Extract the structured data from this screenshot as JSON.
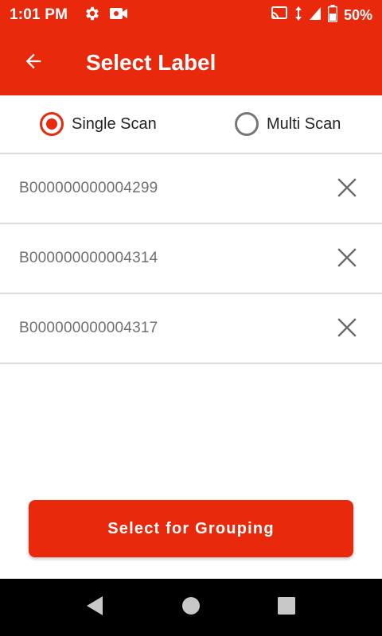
{
  "status_bar": {
    "time": "1:01 PM",
    "battery": "50%",
    "icons": [
      "settings-gear-icon",
      "video-camera-icon",
      "cast-icon",
      "data-arrows-icon",
      "signal-icon",
      "battery-icon"
    ]
  },
  "app_bar": {
    "title": "Select Label",
    "back_icon": "arrow-left-icon"
  },
  "scan_mode": {
    "options": [
      {
        "label": "Single Scan",
        "checked": true
      },
      {
        "label": "Multi Scan",
        "checked": false
      }
    ]
  },
  "labels": [
    {
      "code": "B000000000004299"
    },
    {
      "code": "B000000000004314"
    },
    {
      "code": "B000000000004317"
    }
  ],
  "actions": {
    "primary_label": "Select for Grouping"
  },
  "colors": {
    "accent": "#e8290b",
    "divider": "#dcdcdc",
    "text_muted": "#707070"
  },
  "nav_bar": {
    "icons": [
      "nav-back-icon",
      "nav-home-icon",
      "nav-recents-icon"
    ]
  }
}
